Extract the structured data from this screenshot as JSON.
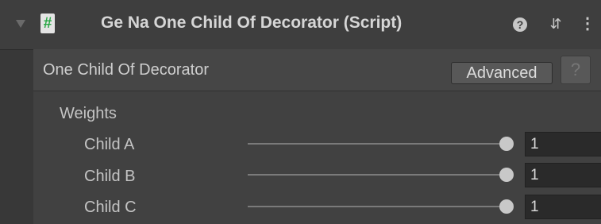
{
  "component": {
    "title": "Ge Na One Child Of Decorator (Script)",
    "icons": {
      "foldout": "triangle-down-icon",
      "script": "script-icon",
      "script_glyph": "#",
      "help": "help-icon",
      "settings": "preset-settings-icon",
      "menu": "kebab-menu-icon"
    }
  },
  "section": {
    "title": "One Child Of Decorator",
    "advanced_label": "Advanced",
    "help_label": "?"
  },
  "weights": {
    "label": "Weights",
    "slider_min": 0,
    "slider_max": 1,
    "items": [
      {
        "label": "Child A",
        "value": "1",
        "fraction": 1.0
      },
      {
        "label": "Child B",
        "value": "1",
        "fraction": 1.0
      },
      {
        "label": "Child C",
        "value": "1",
        "fraction": 1.0
      }
    ]
  },
  "colors": {
    "background": "#383838",
    "header": "#3e3e3e",
    "script_icon_hash": "#28a745"
  }
}
